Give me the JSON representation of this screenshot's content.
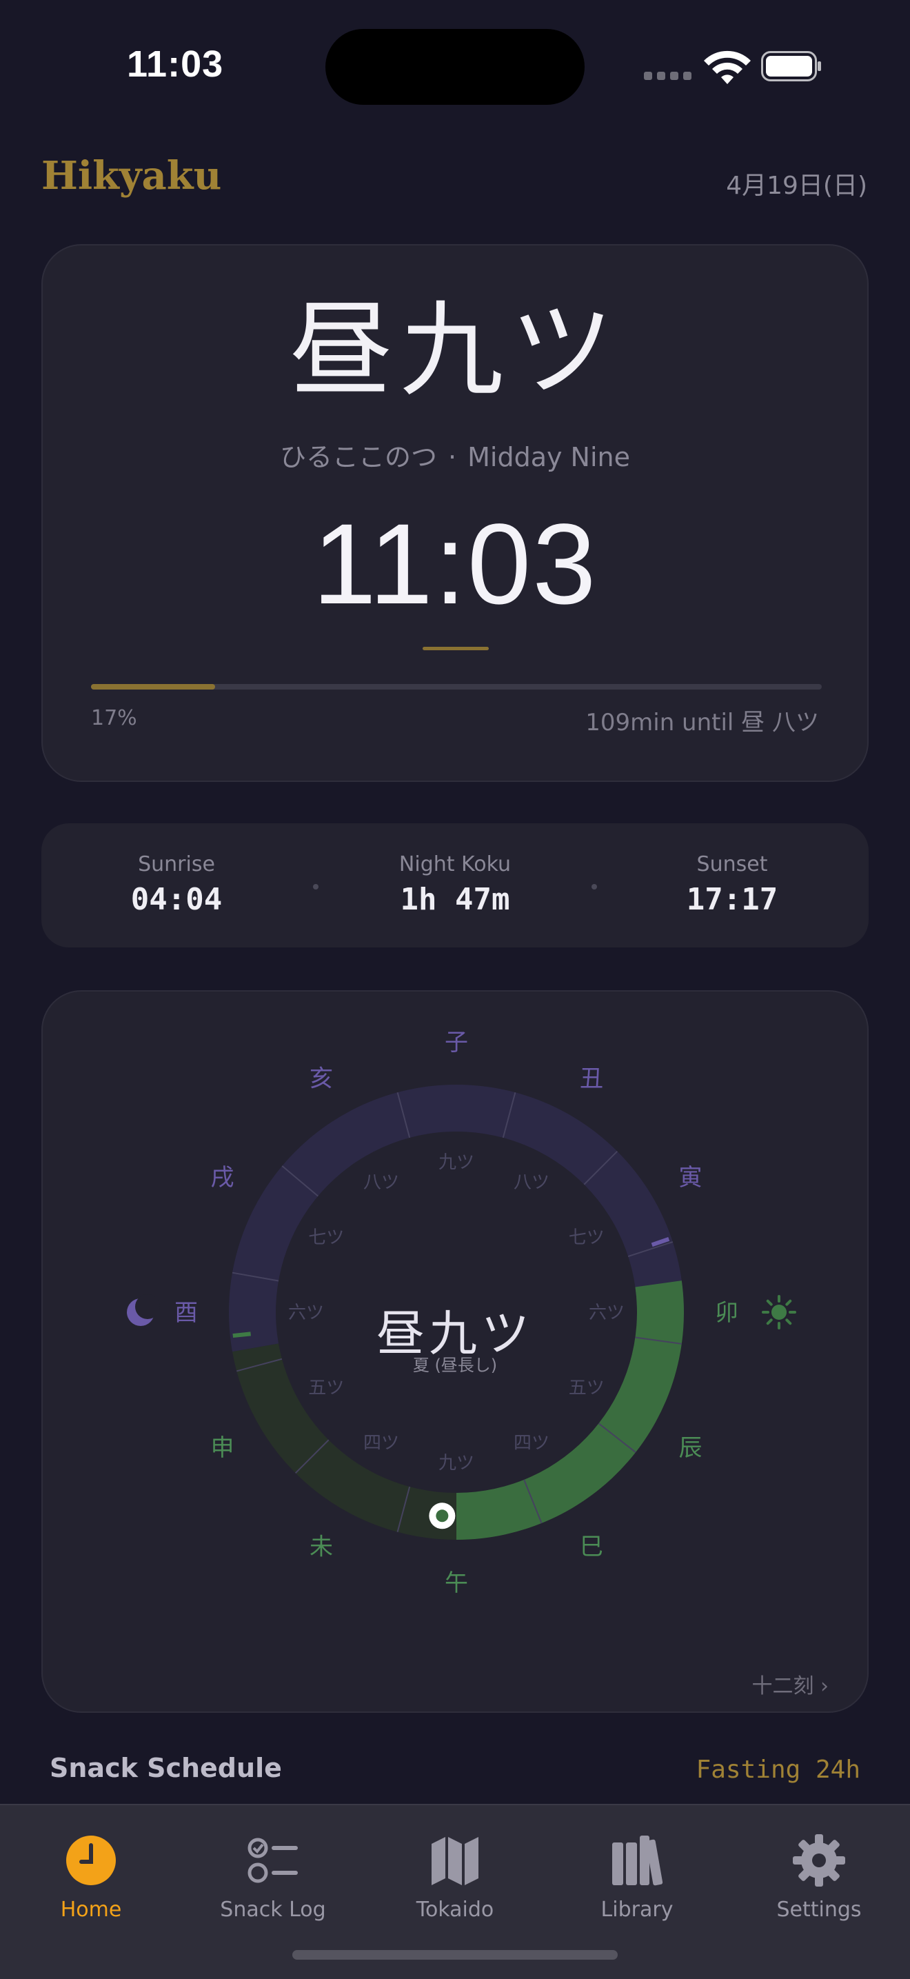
{
  "status_bar": {
    "time": "11:03"
  },
  "header": {
    "brand": "Hikyaku",
    "date": "4月19日(日)"
  },
  "current_koku": {
    "kanji": "昼九ツ",
    "reading": "ひるここのつ",
    "separator": "·",
    "english": "Midday Nine",
    "time": "11:03",
    "progress": 0.17,
    "progress_label": "17%",
    "until_label": "109min until 昼 八ツ"
  },
  "sun": {
    "sunrise_label": "Sunrise",
    "sunrise": "04:04",
    "night_label": "Night Koku",
    "night": "1h 47m",
    "sunset_label": "Sunset",
    "sunset": "17:17"
  },
  "wheel": {
    "center_title": "昼九ツ",
    "center_sub": "夏 (昼長し)",
    "zodiac_labels": [
      "子",
      "丑",
      "寅",
      "卯",
      "辰",
      "巳",
      "午",
      "未",
      "申",
      "酉",
      "戌",
      "亥"
    ],
    "inner_labels": [
      "九ツ",
      "八ツ",
      "七ツ",
      "六ツ",
      "五ツ",
      "四ツ",
      "九ツ",
      "四ツ",
      "五ツ",
      "六ツ",
      "七ツ",
      "八ツ"
    ],
    "more_label": "十二刻 ›",
    "colors": {
      "night": "#6a5aa8",
      "day": "#4b8c55",
      "day_bright": "#3e7a45"
    }
  },
  "snack": {
    "title": "Snack Schedule",
    "state": "Fasting 24h"
  },
  "tabs": [
    {
      "label": "Home",
      "icon": "clock-icon",
      "active": true
    },
    {
      "label": "Snack Log",
      "icon": "checklist-icon",
      "active": false
    },
    {
      "label": "Tokaido",
      "icon": "map-icon",
      "active": false
    },
    {
      "label": "Library",
      "icon": "books-icon",
      "active": false
    },
    {
      "label": "Settings",
      "icon": "gear-icon",
      "active": false
    }
  ]
}
